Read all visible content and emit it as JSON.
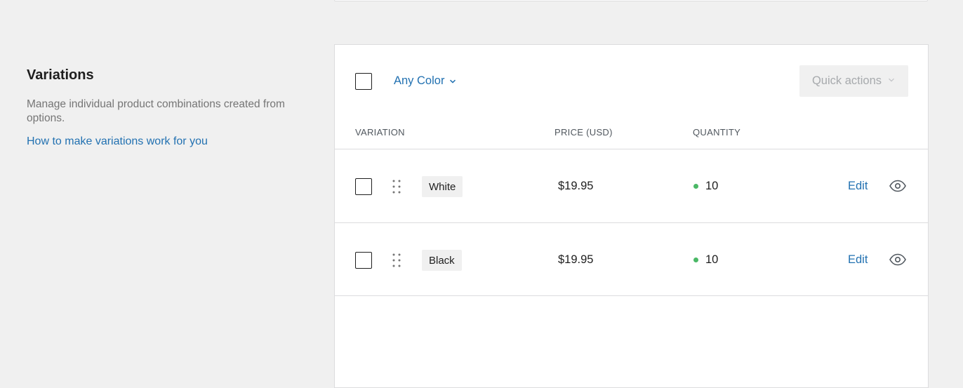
{
  "section": {
    "title": "Variations",
    "description": "Manage individual product combinations created from options.",
    "help_link": "How to make variations work for you"
  },
  "toolbar": {
    "filter_label": "Any Color",
    "quick_actions_label": "Quick actions",
    "quick_actions_enabled": false
  },
  "table": {
    "headers": {
      "variation": "VARIATION",
      "price": "PRICE (USD)",
      "quantity": "QUANTITY"
    },
    "rows": [
      {
        "variation": "White",
        "price": "$19.95",
        "quantity": "10",
        "edit_label": "Edit",
        "stock_status_color": "#4ab866",
        "checked": false
      },
      {
        "variation": "Black",
        "price": "$19.95",
        "quantity": "10",
        "edit_label": "Edit",
        "stock_status_color": "#4ab866",
        "checked": false
      }
    ]
  },
  "colors": {
    "accent": "#2271b1",
    "background": "#f0f0f0",
    "card": "#ffffff",
    "border": "#dcdcde",
    "in_stock": "#4ab866"
  },
  "icons": {
    "filter": "chevron-down-icon",
    "quick_actions": "chevron-down-icon",
    "row_drag": "drag-handle-icon",
    "row_visibility": "eye-icon"
  }
}
